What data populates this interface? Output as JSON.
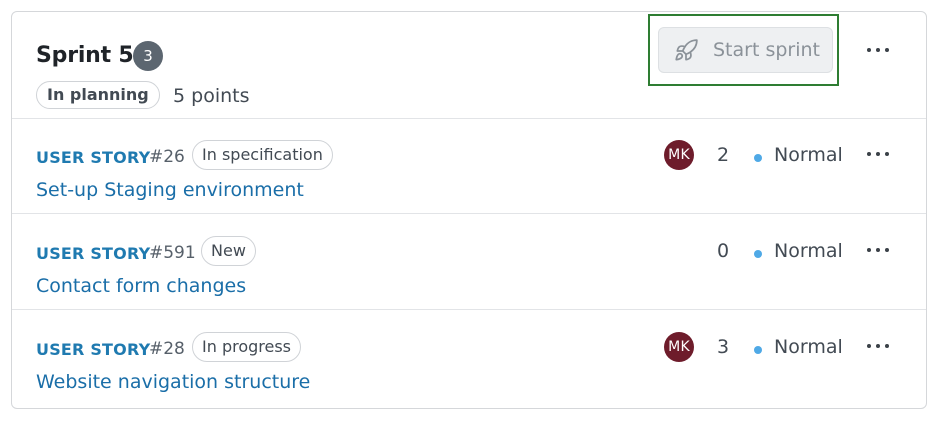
{
  "sprint": {
    "title": "Sprint 5",
    "item_count": "3",
    "status": "In planning",
    "points": "5 points",
    "start_button_label": "Start sprint",
    "start_button_icon": "rocket-icon",
    "more_icon": "more-horizontal-icon"
  },
  "items": [
    {
      "type": "USER STORY",
      "ref": "#26",
      "state": "In specification",
      "title": "Set-up Staging environment",
      "assignee_initials": "MK",
      "estimate": "2",
      "priority": "Normal"
    },
    {
      "type": "USER STORY",
      "ref": "#591",
      "state": "New",
      "title": "Contact form changes",
      "assignee_initials": "",
      "estimate": "0",
      "priority": "Normal"
    },
    {
      "type": "USER STORY",
      "ref": "#28",
      "state": "In progress",
      "title": "Website navigation structure",
      "assignee_initials": "MK",
      "estimate": "3",
      "priority": "Normal"
    }
  ],
  "colors": {
    "type_label": "#1f7ab0",
    "story_link": "#1a6ea8",
    "avatar_bg": "#6e1c2b",
    "priority_dot": "#4fa9e6",
    "focus_outline": "#2e7d32",
    "count_badge": "#5c6670"
  }
}
